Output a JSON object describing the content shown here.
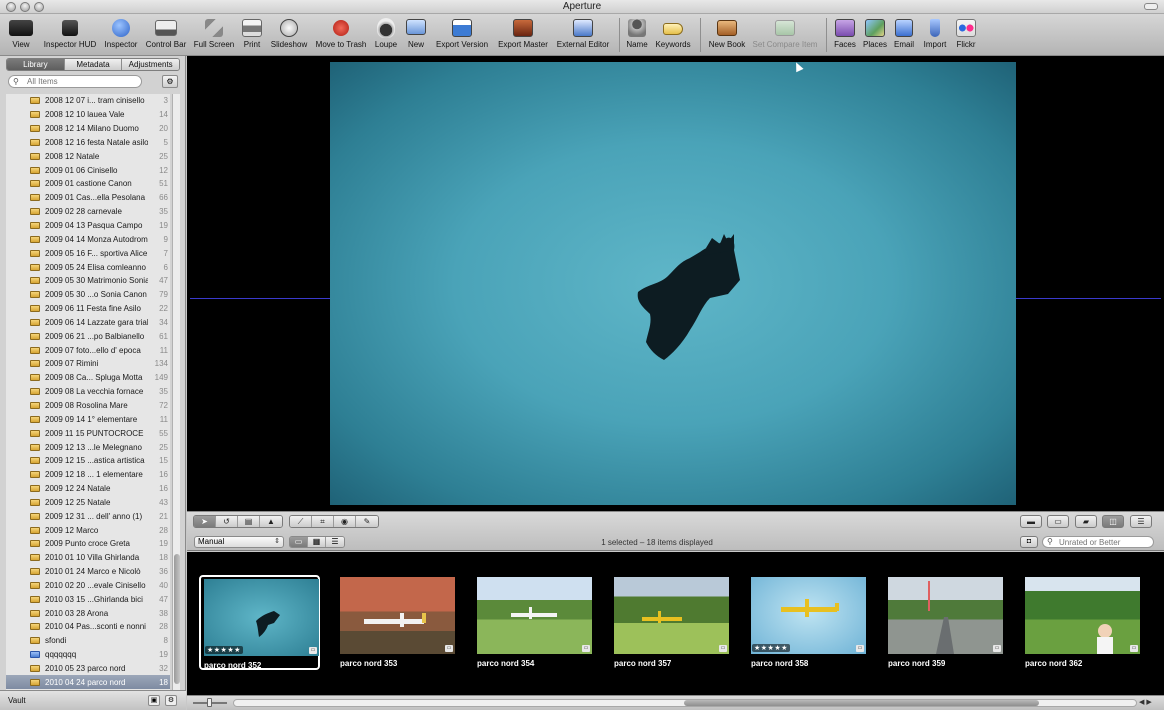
{
  "window": {
    "title": "Aperture"
  },
  "toolbar": {
    "view": "View",
    "inspector_hud": "Inspector HUD",
    "inspector": "Inspector",
    "control_bar": "Control Bar",
    "full_screen": "Full Screen",
    "print": "Print",
    "slideshow": "Slideshow",
    "move_to_trash": "Move to Trash",
    "loupe": "Loupe",
    "new": "New",
    "export_version": "Export Version",
    "export_master": "Export Master",
    "external_editor": "External Editor",
    "name": "Name",
    "keywords": "Keywords",
    "new_book": "New Book",
    "set_compare_item": "Set Compare Item",
    "faces": "Faces",
    "places": "Places",
    "email": "Email",
    "import": "Import",
    "flickr": "Flickr"
  },
  "sidebar": {
    "tabs": [
      "Library",
      "Metadata",
      "Adjustments"
    ],
    "active_tab": "Library",
    "search_placeholder": "All Items",
    "projects": [
      {
        "name": "2008 12 07 i... tram cinisello",
        "count": "3"
      },
      {
        "name": "2008 12 10 lauea Vale",
        "count": "14"
      },
      {
        "name": "2008 12 14 Milano Duomo",
        "count": "20"
      },
      {
        "name": "2008 12 16 festa Natale asilo",
        "count": "5"
      },
      {
        "name": "2008 12 Natale",
        "count": "25"
      },
      {
        "name": "2009 01 06 Cinisello",
        "count": "12"
      },
      {
        "name": "2009 01 castione Canon",
        "count": "51"
      },
      {
        "name": "2009 01 Cas...ella Pesolana",
        "count": "66"
      },
      {
        "name": "2009 02 28 carnevale",
        "count": "35"
      },
      {
        "name": "2009 04 13 Pasqua Campo",
        "count": "19"
      },
      {
        "name": "2009 04 14 Monza Autodromo",
        "count": "9"
      },
      {
        "name": "2009 05 16 F... sportiva Alice",
        "count": "7"
      },
      {
        "name": "2009 05 24 Elisa comleanno",
        "count": "6"
      },
      {
        "name": "2009 05 30 Matrimonio Sonia",
        "count": "47"
      },
      {
        "name": "2009 05 30 ...o Sonia Canon",
        "count": "79"
      },
      {
        "name": "2009 06 11 Festa fine Asilo",
        "count": "22"
      },
      {
        "name": "2009 06 14 Lazzate gara trial",
        "count": "34"
      },
      {
        "name": "2009 06 21 ...po Balbianello",
        "count": "61"
      },
      {
        "name": "2009 07 foto...ello d' epoca",
        "count": "11"
      },
      {
        "name": "2009 07 Rimini",
        "count": "134"
      },
      {
        "name": "2009 08 Ca... Spluga Motta",
        "count": "149"
      },
      {
        "name": "2009 08 La vecchia fornace",
        "count": "35"
      },
      {
        "name": "2009 08 Rosolina Mare",
        "count": "72"
      },
      {
        "name": "2009 09 14 1° elementare",
        "count": "11"
      },
      {
        "name": "2009 11 15 PUNTOCROCE",
        "count": "55"
      },
      {
        "name": "2009 12 13 ...le Melegnano",
        "count": "25"
      },
      {
        "name": "2009 12 15 ...astica artistica",
        "count": "15"
      },
      {
        "name": "2009 12 18 ... 1 elementare",
        "count": "16"
      },
      {
        "name": "2009 12 24 Natale",
        "count": "16"
      },
      {
        "name": "2009 12 25 Natale",
        "count": "43"
      },
      {
        "name": "2009 12 31 ... dell' anno (1)",
        "count": "21"
      },
      {
        "name": "2009 12 Marco",
        "count": "28"
      },
      {
        "name": "2009 Punto croce Greta",
        "count": "19"
      },
      {
        "name": "2010 01 10 Villa Ghirlanda",
        "count": "18"
      },
      {
        "name": "2010 01 24 Marco e Nicolò",
        "count": "36"
      },
      {
        "name": "2010 02 20 ...evale Cinisello",
        "count": "40"
      },
      {
        "name": "2010 03 15 ...Ghirlanda bici",
        "count": "47"
      },
      {
        "name": "2010 03 28 Arona",
        "count": "38"
      },
      {
        "name": "2010 04 Pas...sconti e nonni",
        "count": "28"
      },
      {
        "name": "sfondi",
        "count": "8"
      },
      {
        "name": "qqqqqqq",
        "count": "19",
        "icon": "blue"
      },
      {
        "name": "2010 05 23 parco nord",
        "count": "32"
      },
      {
        "name": "2010 04 24 parco nord",
        "count": "18",
        "selected": true
      }
    ],
    "vault_label": "Vault"
  },
  "controlbar": {
    "sort_value": "Manual",
    "status": "1 selected – 18 items displayed",
    "filter_placeholder": "Unrated or Better"
  },
  "browser": {
    "thumbnails": [
      {
        "caption": "parco nord 352",
        "stars": "★★★★★",
        "selected": true,
        "scene": "crow"
      },
      {
        "caption": "parco nord 353",
        "stars": "",
        "scene": "plane-white-hangar"
      },
      {
        "caption": "parco nord 354",
        "stars": "",
        "scene": "plane-white-field"
      },
      {
        "caption": "parco nord 357",
        "stars": "",
        "scene": "plane-yellow-field"
      },
      {
        "caption": "parco nord 358",
        "stars": "★★★★★",
        "scene": "plane-yellow-sky"
      },
      {
        "caption": "parco nord 359",
        "stars": "",
        "scene": "road"
      },
      {
        "caption": "parco nord 362",
        "stars": "",
        "scene": "girl-field"
      }
    ]
  },
  "colors": {
    "sky": "#4aa3b8",
    "selection": "#8593aa",
    "toolbar_bg": "#c4c4c4"
  }
}
